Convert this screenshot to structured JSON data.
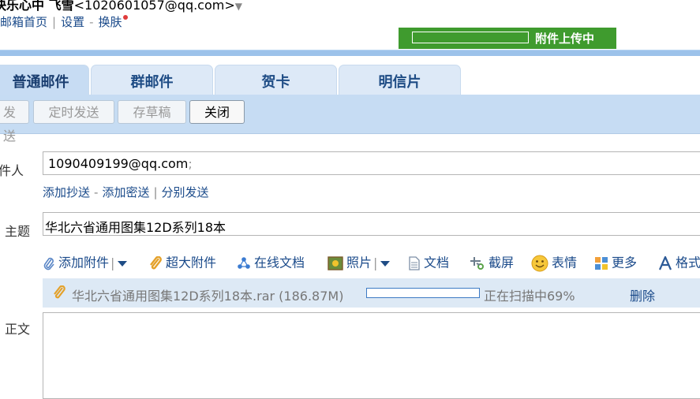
{
  "header": {
    "user_name": "快乐心中 飞雪",
    "user_email": "<1020601057@qq.com>",
    "user_arrow": "▼",
    "links": [
      "邮箱首页",
      "设置",
      "换肤"
    ]
  },
  "upload_status": {
    "label": "附件上传中"
  },
  "tabs": [
    "普通邮件",
    "群邮件",
    "贺卡",
    "明信片"
  ],
  "toolbar": {
    "send": "发送",
    "timed_send": "定时发送",
    "save_draft": "存草稿",
    "close": "关闭"
  },
  "compose": {
    "to_label": "收件人",
    "to_value": "1090409199@qq.com",
    "to_sep": ";",
    "cc_links": [
      "添加抄送",
      "添加密送",
      "分别发送"
    ],
    "subject_label": "主题",
    "subject_value": "华北六省通用图集12D系列18本",
    "body_label": "正文"
  },
  "attach_toolbar": {
    "add_attachment": "添加附件",
    "big_attachment": "超大附件",
    "online_doc": "在线文档",
    "photo": "照片",
    "document": "文档",
    "screenshot": "截屏",
    "emoji": "表情",
    "more": "更多",
    "format": "格式"
  },
  "attachment": {
    "file_name": "华北六省通用图集12D系列18本.rar (186.87M)",
    "status": "正在扫描中69%",
    "delete": "删除",
    "progress": 0.0
  },
  "colors": {
    "upload_green": "#3f9b2e",
    "link_blue": "#1a4a8a",
    "tab_bg": "#dde9f7",
    "toolbar_bg": "#c6dcf3"
  }
}
